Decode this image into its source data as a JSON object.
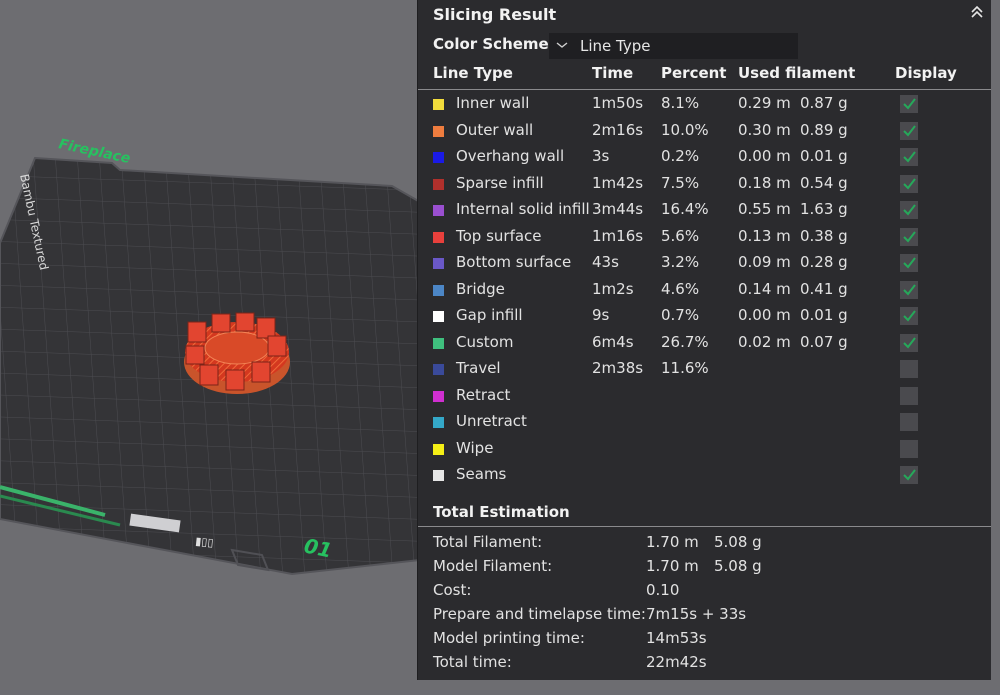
{
  "plate": {
    "brand_text": "Bambu Textured",
    "name": "Fireplace",
    "number": "01"
  },
  "panel": {
    "title": "Slicing Result",
    "color_scheme_label": "Color Scheme",
    "color_scheme_value": "Line Type"
  },
  "columns": [
    "Line Type",
    "Time",
    "Percent",
    "Used filament",
    "Display"
  ],
  "rows": [
    {
      "name": "Inner wall",
      "color": "#f2dc3c",
      "time": "1m50s",
      "percent": "8.1%",
      "length": "0.29 m",
      "weight": "0.87 g",
      "display": true
    },
    {
      "name": "Outer wall",
      "color": "#ef7d3f",
      "time": "2m16s",
      "percent": "10.0%",
      "length": "0.30 m",
      "weight": "0.89 g",
      "display": true
    },
    {
      "name": "Overhang wall",
      "color": "#1a1ae6",
      "time": "3s",
      "percent": "0.2%",
      "length": "0.00 m",
      "weight": "0.01 g",
      "display": true
    },
    {
      "name": "Sparse infill",
      "color": "#b0302c",
      "time": "1m42s",
      "percent": "7.5%",
      "length": "0.18 m",
      "weight": "0.54 g",
      "display": true
    },
    {
      "name": "Internal solid infill",
      "color": "#9a4fd0",
      "time": "3m44s",
      "percent": "16.4%",
      "length": "0.55 m",
      "weight": "1.63 g",
      "display": true
    },
    {
      "name": "Top surface",
      "color": "#e8403c",
      "time": "1m16s",
      "percent": "5.6%",
      "length": "0.13 m",
      "weight": "0.38 g",
      "display": true
    },
    {
      "name": "Bottom surface",
      "color": "#6a58c8",
      "time": "43s",
      "percent": "3.2%",
      "length": "0.09 m",
      "weight": "0.28 g",
      "display": true
    },
    {
      "name": "Bridge",
      "color": "#4c86c6",
      "time": "1m2s",
      "percent": "4.6%",
      "length": "0.14 m",
      "weight": "0.41 g",
      "display": true
    },
    {
      "name": "Gap infill",
      "color": "#ffffff",
      "time": "9s",
      "percent": "0.7%",
      "length": "0.00 m",
      "weight": "0.01 g",
      "display": true
    },
    {
      "name": "Custom",
      "color": "#3fc07e",
      "time": "6m4s",
      "percent": "26.7%",
      "length": "0.02 m",
      "weight": "0.07 g",
      "display": true
    },
    {
      "name": "Travel",
      "color": "#3a4a9a",
      "time": "2m38s",
      "percent": "11.6%",
      "length": "",
      "weight": "",
      "display": false
    },
    {
      "name": "Retract",
      "color": "#d02fd0",
      "time": "",
      "percent": "",
      "length": "",
      "weight": "",
      "display": false
    },
    {
      "name": "Unretract",
      "color": "#34a8c8",
      "time": "",
      "percent": "",
      "length": "",
      "weight": "",
      "display": false
    },
    {
      "name": "Wipe",
      "color": "#f5ef16",
      "time": "",
      "percent": "",
      "length": "",
      "weight": "",
      "display": false
    },
    {
      "name": "Seams",
      "color": "#e6e6e6",
      "time": "",
      "percent": "",
      "length": "",
      "weight": "",
      "display": true
    }
  ],
  "total": {
    "title": "Total Estimation",
    "items": [
      {
        "label": "Total Filament:",
        "value": "1.70 m",
        "value2": "5.08 g"
      },
      {
        "label": "Model Filament:",
        "value": "1.70 m",
        "value2": "5.08 g"
      },
      {
        "label": "Cost:",
        "value": "0.10",
        "value2": ""
      },
      {
        "label": "Prepare and timelapse time:",
        "value": "7m15s + 33s",
        "value2": ""
      },
      {
        "label": "Model printing time:",
        "value": "14m53s",
        "value2": ""
      },
      {
        "label": "Total time:",
        "value": "22m42s",
        "value2": ""
      }
    ]
  },
  "colors": {
    "check": "#26a85a",
    "panel_bg": "#2b2b2e",
    "plate_label": "#27c160"
  }
}
